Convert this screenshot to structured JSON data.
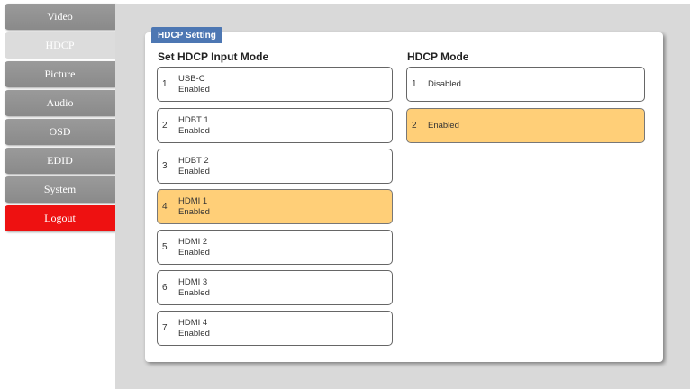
{
  "sidebar": {
    "items": [
      {
        "label": "Video"
      },
      {
        "label": "HDCP"
      },
      {
        "label": "Picture"
      },
      {
        "label": "Audio"
      },
      {
        "label": "OSD"
      },
      {
        "label": "EDID"
      },
      {
        "label": "System"
      },
      {
        "label": "Logout"
      }
    ],
    "active": "HDCP"
  },
  "panel": {
    "tab_label": "HDCP Setting",
    "input_mode": {
      "heading": "Set HDCP Input Mode",
      "options": [
        {
          "num": "1",
          "name": "USB-C",
          "status": "Enabled"
        },
        {
          "num": "2",
          "name": "HDBT 1",
          "status": "Enabled"
        },
        {
          "num": "3",
          "name": "HDBT 2",
          "status": "Enabled"
        },
        {
          "num": "4",
          "name": "HDMI 1",
          "status": "Enabled"
        },
        {
          "num": "5",
          "name": "HDMI 2",
          "status": "Enabled"
        },
        {
          "num": "6",
          "name": "HDMI 3",
          "status": "Enabled"
        },
        {
          "num": "7",
          "name": "HDMI 4",
          "status": "Enabled"
        }
      ],
      "selected": "4"
    },
    "hdcp_mode": {
      "heading": "HDCP Mode",
      "options": [
        {
          "num": "1",
          "label": "Disabled"
        },
        {
          "num": "2",
          "label": "Enabled"
        }
      ],
      "selected": "2"
    }
  },
  "colors": {
    "nav_gray": "#8f8f8f",
    "nav_active": "#dcdcdc",
    "logout_red": "#ee1111",
    "tab_blue": "#4d77b3",
    "selected_orange": "#ffcf78"
  }
}
